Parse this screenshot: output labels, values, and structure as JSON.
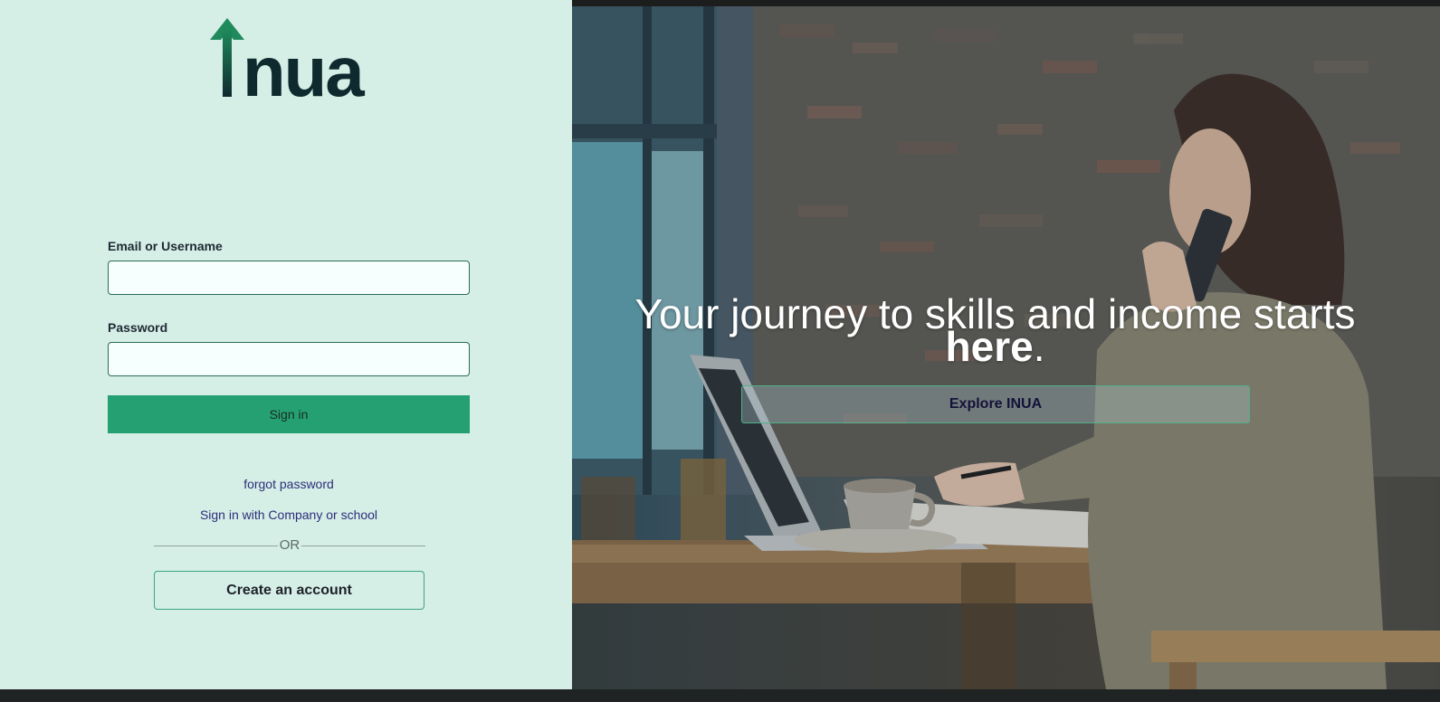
{
  "brand": {
    "logo_text": "nua",
    "logo_alt": "Inua",
    "logo_arrow_color": "#1f8a5c",
    "logo_text_color": "#0f2a2e"
  },
  "login_form": {
    "email_label": "Email or Username",
    "email_value": "",
    "password_label": "Password",
    "password_value": "",
    "signin_label": "Sign in"
  },
  "links": {
    "forgot_password": "forgot password",
    "sso_signin": "Sign in with Company or school"
  },
  "divider": {
    "text": "OR"
  },
  "create_account_label": "Create an account",
  "hero": {
    "headline_part1": "Your journey to skills and income starts",
    "headline_part2": "here",
    "headline_end": ".",
    "explore_label": "Explore INUA"
  },
  "colors": {
    "left_panel_bg": "#d5eee6",
    "primary_green": "#24a072",
    "link_color": "#2b2f7a"
  }
}
